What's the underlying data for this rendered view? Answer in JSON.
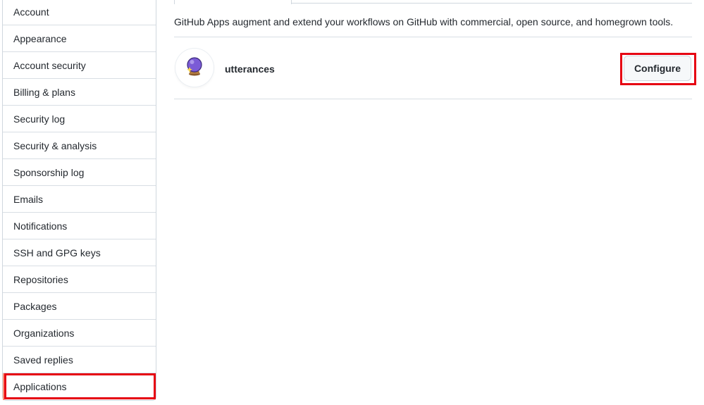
{
  "sidebar": {
    "items": [
      {
        "label": "Account"
      },
      {
        "label": "Appearance"
      },
      {
        "label": "Account security"
      },
      {
        "label": "Billing & plans"
      },
      {
        "label": "Security log"
      },
      {
        "label": "Security & analysis"
      },
      {
        "label": "Sponsorship log"
      },
      {
        "label": "Emails"
      },
      {
        "label": "Notifications"
      },
      {
        "label": "SSH and GPG keys"
      },
      {
        "label": "Repositories"
      },
      {
        "label": "Packages"
      },
      {
        "label": "Organizations"
      },
      {
        "label": "Saved replies"
      },
      {
        "label": "Applications",
        "selected": true
      }
    ]
  },
  "main": {
    "intro": "GitHub Apps augment and extend your workflows on GitHub with commercial, open source, and homegrown tools.",
    "apps": [
      {
        "name": "utterances",
        "icon": "crystal-ball-icon",
        "action_label": "Configure"
      }
    ]
  },
  "colors": {
    "highlight": "#e60012",
    "selected_accent": "#fd8c73",
    "border": "#d0d7de",
    "button_bg": "#f6f8fa"
  }
}
